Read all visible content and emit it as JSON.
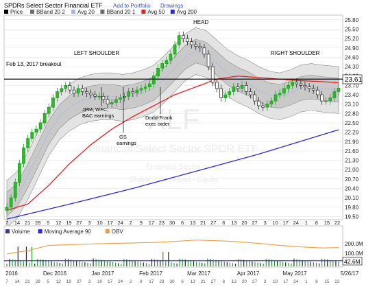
{
  "header": {
    "title": "SPDRs Select Sector Financial ETF",
    "actions": [
      "Add to Portfolio",
      "Drawings"
    ]
  },
  "legend": [
    {
      "label": "Price",
      "color": "#000000"
    },
    {
      "label": "BBand 20 2",
      "color": "#6e6e6e"
    },
    {
      "label": "Avg 20",
      "color": "#a8b3e6"
    },
    {
      "label": "BBand 20 1",
      "color": "#6e6e6e"
    },
    {
      "label": "Avg 50",
      "color": "#e8201f"
    },
    {
      "label": "Avg 200",
      "color": "#2a2ad4"
    }
  ],
  "watermark": {
    "symbol": "XLF",
    "name": "Financial Select Sector SPDR ETF",
    "sub1": "Financial Sector",
    "sub2": "Global Index Fund · Equity"
  },
  "annotations": {
    "breakout": "Feb 13, 2017 breakout",
    "left_shoulder": "LEFT SHOULDER",
    "head": "HEAD",
    "right_shoulder": "RIGHT SHOULDER",
    "jpm": [
      "JPM, WFC,",
      "BAC earnings"
    ],
    "gs": [
      "GS",
      "earnings"
    ],
    "dodd": [
      "Dodd-Frank",
      "exec order"
    ]
  },
  "last_price": "23.61",
  "volume_panel": {
    "legend": [
      {
        "label": "Volume",
        "color": "#3a3a8c"
      },
      {
        "label": "Moving Average 90",
        "color": "#2a2ad4"
      },
      {
        "label": "OBV",
        "color": "#f09a3e"
      }
    ],
    "ticks": [
      "200.0M",
      "100.0M"
    ],
    "last_value": "42.6M"
  },
  "chart_data": {
    "type": "candlestick",
    "y_ticks": [
      "19.50",
      "19.80",
      "20.10",
      "20.40",
      "20.70",
      "21.00",
      "21.30",
      "21.60",
      "21.90",
      "22.20",
      "22.50",
      "22.80",
      "23.10",
      "23.40",
      "23.70",
      "24.00",
      "24.30",
      "24.60",
      "24.90",
      "25.20",
      "25.50",
      "25.80"
    ],
    "ylim": [
      19.4,
      25.95
    ],
    "x_tick_labels": [
      "7",
      "14",
      "21",
      "28",
      "5",
      "12",
      "19",
      "27",
      "3",
      "10",
      "17",
      "24",
      "2",
      "9",
      "17",
      "23",
      "30",
      "6",
      "13",
      "21",
      "27",
      "6",
      "13",
      "20",
      "27",
      "3",
      "10",
      "17",
      "24",
      "1",
      "8",
      "15",
      "22"
    ],
    "x_labels": [
      "2016",
      "Dec 2016",
      "Jan 2017",
      "Feb 2017",
      "Mar 2017",
      "Apr 2017",
      "May 2017",
      "5/26/17"
    ],
    "resistance_level": 23.9,
    "price_series": [
      [
        0,
        19.8
      ],
      [
        4,
        20.1
      ],
      [
        8,
        20.6
      ],
      [
        12,
        21.2
      ],
      [
        16,
        21.7
      ],
      [
        20,
        22.0
      ],
      [
        24,
        22.2
      ],
      [
        28,
        22.3
      ],
      [
        32,
        22.5
      ],
      [
        36,
        22.8
      ],
      [
        40,
        23.0
      ],
      [
        44,
        23.3
      ],
      [
        48,
        23.5
      ],
      [
        52,
        23.6
      ],
      [
        56,
        23.7
      ],
      [
        60,
        23.55
      ],
      [
        64,
        23.45
      ],
      [
        68,
        23.6
      ],
      [
        72,
        23.5
      ],
      [
        76,
        23.45
      ],
      [
        80,
        23.4
      ],
      [
        84,
        23.35
      ],
      [
        88,
        23.35
      ],
      [
        92,
        23.25
      ],
      [
        96,
        23.1
      ],
      [
        100,
        23.15
      ],
      [
        104,
        23.25
      ],
      [
        108,
        23.3
      ],
      [
        112,
        23.35
      ],
      [
        116,
        23.5
      ],
      [
        120,
        23.45
      ],
      [
        124,
        23.55
      ],
      [
        128,
        23.6
      ],
      [
        132,
        23.65
      ],
      [
        136,
        23.75
      ],
      [
        140,
        24.0
      ],
      [
        144,
        24.25
      ],
      [
        148,
        24.4
      ],
      [
        152,
        24.5
      ],
      [
        156,
        24.7
      ],
      [
        160,
        25.0
      ],
      [
        164,
        25.3
      ],
      [
        168,
        25.2
      ],
      [
        172,
        25.1
      ],
      [
        176,
        25.0
      ],
      [
        180,
        24.95
      ],
      [
        184,
        24.9
      ],
      [
        188,
        24.7
      ],
      [
        192,
        24.3
      ],
      [
        196,
        23.8
      ],
      [
        200,
        23.6
      ],
      [
        204,
        23.3
      ],
      [
        208,
        23.4
      ],
      [
        212,
        23.5
      ],
      [
        216,
        23.65
      ],
      [
        220,
        23.6
      ],
      [
        224,
        23.7
      ],
      [
        228,
        23.5
      ],
      [
        232,
        23.4
      ],
      [
        236,
        23.2
      ],
      [
        240,
        23.05
      ],
      [
        244,
        23.0
      ],
      [
        248,
        23.1
      ],
      [
        252,
        23.2
      ],
      [
        256,
        23.4
      ],
      [
        260,
        23.45
      ],
      [
        264,
        23.6
      ],
      [
        268,
        23.7
      ],
      [
        272,
        23.8
      ],
      [
        276,
        23.75
      ],
      [
        280,
        23.7
      ],
      [
        284,
        23.65
      ],
      [
        288,
        23.6
      ],
      [
        292,
        23.55
      ],
      [
        296,
        23.4
      ],
      [
        300,
        23.2
      ],
      [
        304,
        23.2
      ],
      [
        308,
        23.3
      ],
      [
        312,
        23.5
      ],
      [
        316,
        23.61
      ]
    ],
    "avg50_series": [
      [
        0,
        19.7
      ],
      [
        20,
        19.9
      ],
      [
        40,
        20.5
      ],
      [
        60,
        21.2
      ],
      [
        80,
        21.8
      ],
      [
        100,
        22.3
      ],
      [
        120,
        22.7
      ],
      [
        140,
        23.05
      ],
      [
        160,
        23.4
      ],
      [
        180,
        23.65
      ],
      [
        200,
        23.9
      ],
      [
        220,
        24.0
      ],
      [
        240,
        23.95
      ],
      [
        260,
        23.9
      ],
      [
        280,
        23.85
      ],
      [
        300,
        23.82
      ],
      [
        316,
        23.78
      ]
    ],
    "avg20_series": [
      [
        0,
        19.9
      ],
      [
        10,
        20.2
      ],
      [
        20,
        20.8
      ],
      [
        30,
        21.5
      ],
      [
        40,
        22.2
      ],
      [
        50,
        22.7
      ],
      [
        60,
        23.0
      ],
      [
        70,
        23.2
      ],
      [
        80,
        23.3
      ],
      [
        90,
        23.35
      ],
      [
        100,
        23.35
      ],
      [
        110,
        23.3
      ],
      [
        120,
        23.35
      ],
      [
        130,
        23.45
      ],
      [
        140,
        23.6
      ],
      [
        150,
        23.9
      ],
      [
        160,
        24.25
      ],
      [
        170,
        24.6
      ],
      [
        180,
        24.8
      ],
      [
        190,
        24.7
      ],
      [
        200,
        24.4
      ],
      [
        210,
        24.1
      ],
      [
        220,
        23.9
      ],
      [
        230,
        23.75
      ],
      [
        240,
        23.55
      ],
      [
        250,
        23.4
      ],
      [
        260,
        23.35
      ],
      [
        270,
        23.45
      ],
      [
        280,
        23.6
      ],
      [
        290,
        23.65
      ],
      [
        300,
        23.6
      ],
      [
        316,
        23.55
      ]
    ],
    "avg200_series": [
      [
        0,
        19.42
      ],
      [
        60,
        19.9
      ],
      [
        120,
        20.4
      ],
      [
        180,
        20.95
      ],
      [
        240,
        21.5
      ],
      [
        316,
        22.28
      ]
    ],
    "volume_ma90": 42.6,
    "obv_series": [
      [
        0,
        95
      ],
      [
        20,
        120
      ],
      [
        40,
        160
      ],
      [
        60,
        165
      ],
      [
        80,
        170
      ],
      [
        100,
        175
      ],
      [
        120,
        178
      ],
      [
        140,
        182
      ],
      [
        160,
        190
      ],
      [
        180,
        200
      ],
      [
        200,
        195
      ],
      [
        220,
        188
      ],
      [
        240,
        175
      ],
      [
        260,
        160
      ],
      [
        280,
        148
      ],
      [
        300,
        140
      ],
      [
        316,
        143
      ]
    ]
  }
}
